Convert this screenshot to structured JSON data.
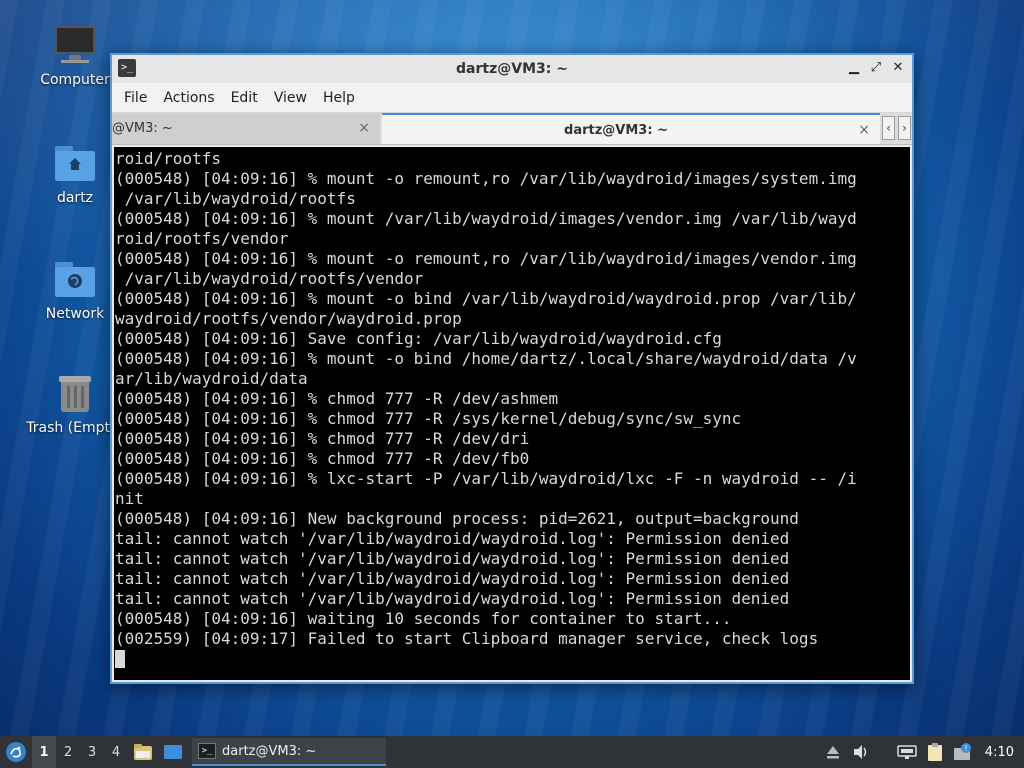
{
  "desktop": {
    "icons": [
      {
        "label": "Computer",
        "icon": "computer-icon"
      },
      {
        "label": "dartz",
        "icon": "home-folder-icon"
      },
      {
        "label": "Network",
        "icon": "network-folder-icon"
      },
      {
        "label": "Trash (Empty)",
        "icon": "trash-icon"
      }
    ]
  },
  "window": {
    "title": "dartz@VM3: ~",
    "menu": [
      "File",
      "Actions",
      "Edit",
      "View",
      "Help"
    ],
    "tabs": [
      {
        "label": "@VM3: ~",
        "close": "×"
      },
      {
        "label": "dartz@VM3: ~",
        "close": "×"
      }
    ],
    "controls": {
      "minimize": "▁",
      "maximize": "⤢",
      "close": "✕"
    }
  },
  "terminal": {
    "lines": [
      "roid/rootfs",
      "(000548) [04:09:16] % mount -o remount,ro /var/lib/waydroid/images/system.img",
      " /var/lib/waydroid/rootfs",
      "(000548) [04:09:16] % mount /var/lib/waydroid/images/vendor.img /var/lib/wayd",
      "roid/rootfs/vendor",
      "(000548) [04:09:16] % mount -o remount,ro /var/lib/waydroid/images/vendor.img",
      " /var/lib/waydroid/rootfs/vendor",
      "(000548) [04:09:16] % mount -o bind /var/lib/waydroid/waydroid.prop /var/lib/",
      "waydroid/rootfs/vendor/waydroid.prop",
      "(000548) [04:09:16] Save config: /var/lib/waydroid/waydroid.cfg",
      "(000548) [04:09:16] % mount -o bind /home/dartz/.local/share/waydroid/data /v",
      "ar/lib/waydroid/data",
      "(000548) [04:09:16] % chmod 777 -R /dev/ashmem",
      "(000548) [04:09:16] % chmod 777 -R /sys/kernel/debug/sync/sw_sync",
      "(000548) [04:09:16] % chmod 777 -R /dev/dri",
      "(000548) [04:09:16] % chmod 777 -R /dev/fb0",
      "(000548) [04:09:16] % lxc-start -P /var/lib/waydroid/lxc -F -n waydroid -- /i",
      "nit",
      "(000548) [04:09:16] New background process: pid=2621, output=background",
      "tail: cannot watch '/var/lib/waydroid/waydroid.log': Permission denied",
      "tail: cannot watch '/var/lib/waydroid/waydroid.log': Permission denied",
      "tail: cannot watch '/var/lib/waydroid/waydroid.log': Permission denied",
      "tail: cannot watch '/var/lib/waydroid/waydroid.log': Permission denied",
      "(000548) [04:09:16] waiting 10 seconds for container to start...",
      "(002559) [04:09:17] Failed to start Clipboard manager service, check logs"
    ]
  },
  "taskbar": {
    "workspaces": [
      "1",
      "2",
      "3",
      "4"
    ],
    "active_workspace": "1",
    "task_label": "dartz@VM3: ~",
    "clock": "4:10"
  }
}
